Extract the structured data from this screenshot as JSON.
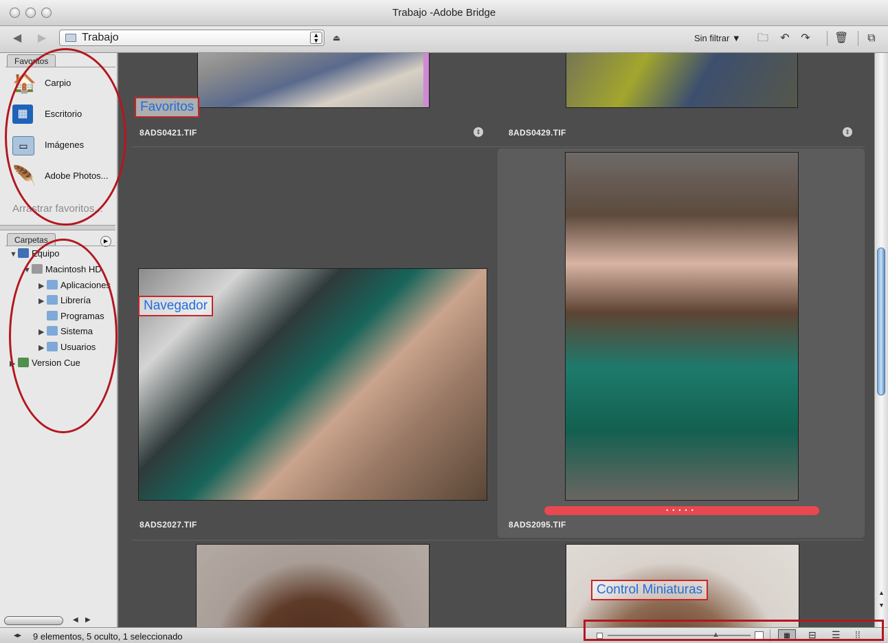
{
  "window": {
    "title": "Trabajo -Adobe Bridge"
  },
  "toolbar": {
    "path": "Trabajo",
    "filter_label": "Sin filtrar ▼"
  },
  "favorites": {
    "tab": "Favoritos",
    "items": [
      {
        "label": "Carpio",
        "icon": "home-icon"
      },
      {
        "label": "Escritorio",
        "icon": "desktop-icon"
      },
      {
        "label": "Imágenes",
        "icon": "pictures-folder-icon"
      },
      {
        "label": "Adobe Photos...",
        "icon": "feather-icon"
      }
    ],
    "drag_hint": "Arrastrar favoritos..."
  },
  "folders": {
    "tab": "Carpetas",
    "tree": [
      {
        "label": "Equipo",
        "level": 0,
        "expanded": true
      },
      {
        "label": "Macintosh HD",
        "level": 1,
        "expanded": true
      },
      {
        "label": "Aplicaciones",
        "level": 2,
        "expanded": false
      },
      {
        "label": "Librería",
        "level": 2,
        "expanded": false
      },
      {
        "label": "Programas",
        "level": 2,
        "expanded": false
      },
      {
        "label": "Sistema",
        "level": 2,
        "expanded": false
      },
      {
        "label": "Usuarios",
        "level": 2,
        "expanded": false
      },
      {
        "label": "Version Cue",
        "level": 0,
        "expanded": false
      }
    ]
  },
  "thumbnails": [
    {
      "name": "8ADS0421.TIF"
    },
    {
      "name": "8ADS0429.TIF"
    },
    {
      "name": "8ADS2027.TIF"
    },
    {
      "name": "8ADS2095.TIF"
    }
  ],
  "status": {
    "text": "9 elementos, 5 oculto, 1 seleccionado"
  },
  "annotations": {
    "favoritos": "Favoritos",
    "navegador": "Navegador",
    "control_miniaturas": "Control Miniaturas"
  },
  "colors": {
    "annotation_red": "#c1272d",
    "annotation_text": "#1e6ee0",
    "content_bg": "#4d4d4d",
    "selection_bar": "#e8484f"
  }
}
